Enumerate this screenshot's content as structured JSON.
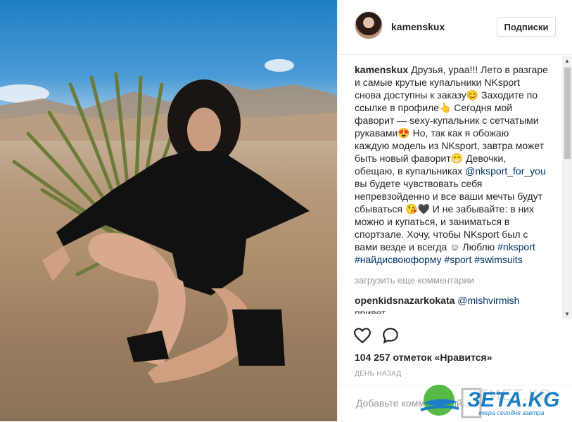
{
  "post": {
    "username": "kamenskux",
    "follow_label": "Подписки",
    "caption_lines": [
      "Друзья, ураа!!! Лето в разгаре",
      "и самые крутые купальники NKsport",
      "снова доступны к заказу😊 Заходите по",
      "ссылке в профиле👆 Сегодня мой",
      "фаворит — sexy-купальник с сетчатыми",
      "рукавами😍 Но, так как я обожаю",
      "каждую модель из NKsport, завтра может",
      "быть новый фаворит😁 Девочки,"
    ],
    "caption_line9_pre": "обещаю, в купальниках ",
    "mention": "@nksport_for_you",
    "caption_lines_2": [
      "вы будете чувствовать себя",
      "непревзойденно и все ваши мечты будут",
      "сбываться 😘🖤 И не забывайте: в них",
      "можно и купаться, и заниматься в",
      "спортзале. Хочу, чтобы NKsport был с"
    ],
    "caption_last_pre": "вами везде и всегда ☺ Люблю ",
    "hashtag1": "#nksport",
    "hashtags_line": "#найдисвоюформу #sport #swimsuits",
    "load_more": "загрузить еще комментарии",
    "comment": {
      "user": "openkidsnazarkokata",
      "mention": "@mishvirmish",
      "text": "привет"
    },
    "likes": "104 257 отметок «Нравится»",
    "time": "ДЕНЬ НАЗАД",
    "add_comment_placeholder": "Добавьте комментарий..."
  },
  "watermark": {
    "brand": "ЗЕТА.KG",
    "ghost": "ТИЕТ.КG",
    "tagline": "вчера сегодня завтра"
  },
  "icons": {
    "like": "heart-icon",
    "comment": "comment-bubble-icon"
  }
}
